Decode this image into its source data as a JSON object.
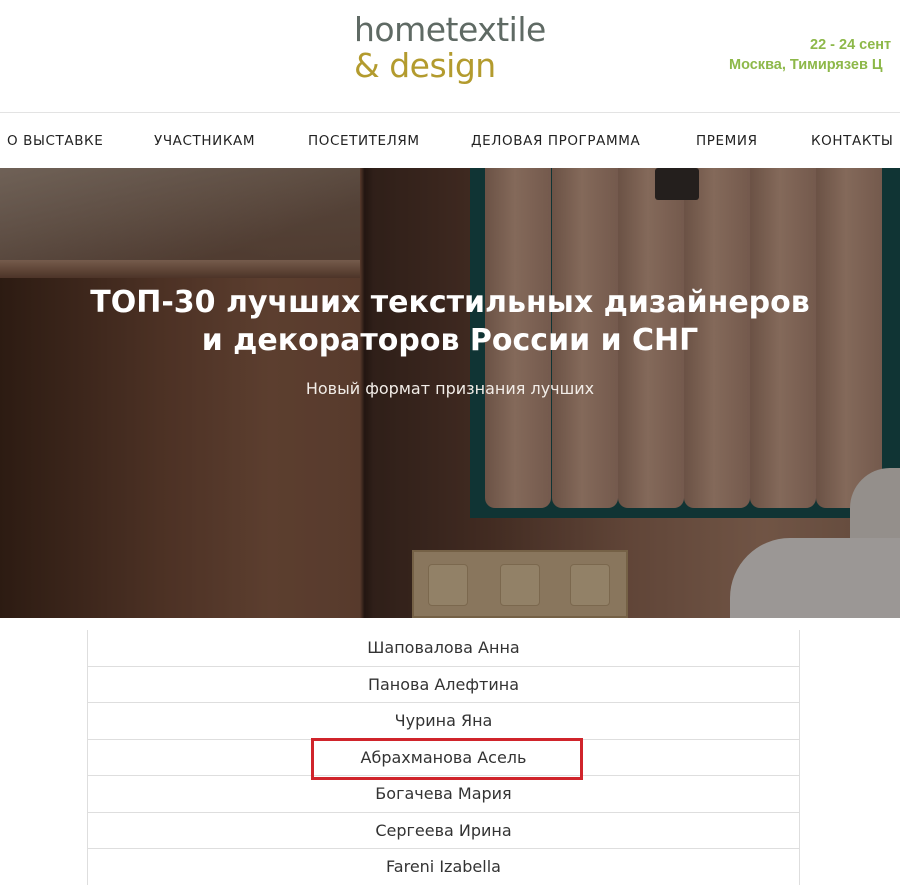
{
  "header": {
    "logo_line1": "hometextile",
    "logo_line2": "& design",
    "date": "22 - 24 сент",
    "place": "Москва, Тимирязев Ц"
  },
  "nav": {
    "items": [
      "О ВЫСТАВКЕ",
      "УЧАСТНИКАМ",
      "ПОСЕТИТЕЛЯМ",
      "ДЕЛОВАЯ ПРОГРАММА",
      "ПРЕМИЯ",
      "КОНТАКТЫ"
    ]
  },
  "hero": {
    "title_line1": "ТОП-30 лучших текстильных дизайнеров",
    "title_line2": "и декораторов России и СНГ",
    "subtitle": "Новый формат признания лучших"
  },
  "list": {
    "rows": [
      "Шаповалова Анна",
      "Панова Алефтина",
      "Чурина Яна",
      "Абрахманова Асель",
      "Богачева Мария",
      "Сергеева Ирина",
      "Fareni Izabella"
    ],
    "highlighted_index": 3
  },
  "colors": {
    "logo_gray": "#5f6a64",
    "logo_gold": "#b39b2e",
    "event_green": "#8db849",
    "highlight_red": "#d0242b"
  }
}
